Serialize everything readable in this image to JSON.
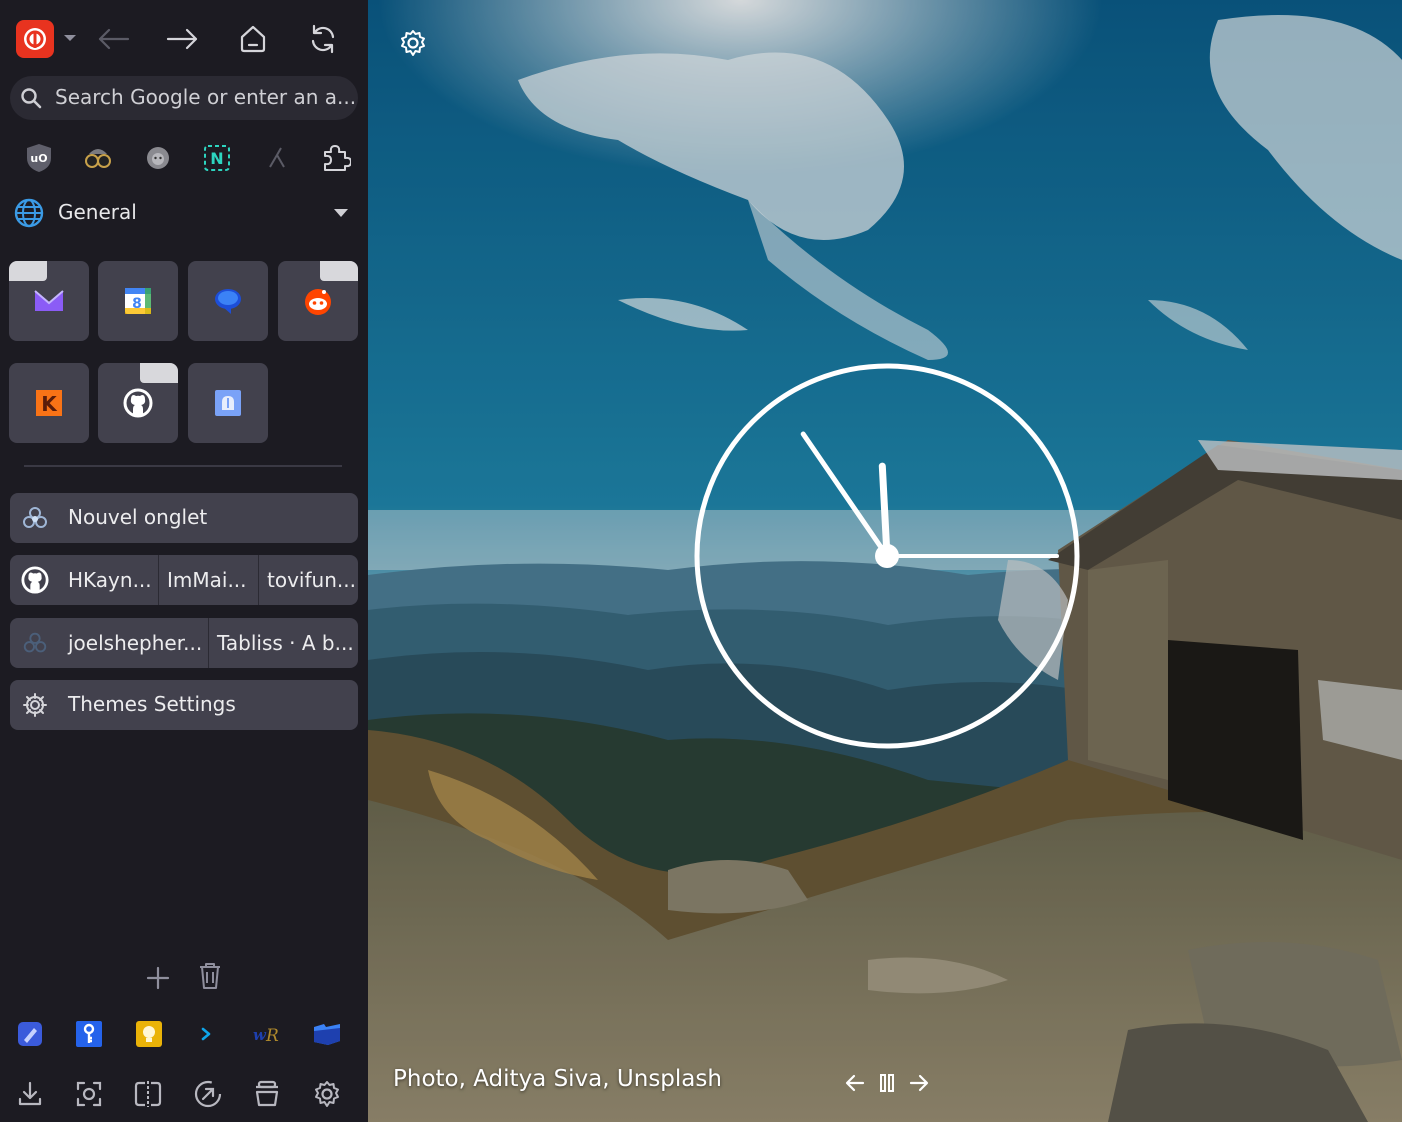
{
  "toolbar": {
    "app_icon": "floorp-logo-icon",
    "dropdown_icon": "chevron-down-icon",
    "back_icon": "arrow-left-icon",
    "forward_icon": "arrow-right-icon",
    "home_icon": "home-icon",
    "reload_icon": "reload-icon"
  },
  "search": {
    "icon": "search-icon",
    "placeholder": "Search Google or enter an a..."
  },
  "extensions": [
    {
      "name": "ublock-origin-icon"
    },
    {
      "name": "spy-glasses-icon"
    },
    {
      "name": "lion-mask-icon"
    },
    {
      "name": "notion-icon"
    },
    {
      "name": "branch-icon"
    },
    {
      "name": "puzzle-piece-icon"
    }
  ],
  "workspace": {
    "label": "General",
    "icon": "globe-icon",
    "caret": "caret-down-icon"
  },
  "pinned": [
    {
      "name": "proton-mail-pin",
      "color": "#8b5cf6"
    },
    {
      "name": "google-calendar-pin",
      "color": "#4285f4"
    },
    {
      "name": "messages-pin",
      "color": "#2563eb"
    },
    {
      "name": "reddit-pin",
      "color": "#ff4500"
    },
    {
      "name": "kagi-pin",
      "color": "#f97316"
    },
    {
      "name": "github-pin",
      "color": "#ffffff"
    },
    {
      "name": "app-pin",
      "color": "#7aa2f7"
    }
  ],
  "tabs": {
    "nouvel_onglet": "Nouvel onglet",
    "split1": [
      "HKayn...",
      "ImMai...",
      "tovifun..."
    ],
    "split2": [
      "joelshepher...",
      "Tabliss · A b..."
    ],
    "themes": "Themes Settings"
  },
  "bottom": {
    "add_icon": "plus-icon",
    "trash_icon": "trash-icon",
    "apps": [
      {
        "name": "blue-pen-app-icon",
        "color": "#3b5bdb"
      },
      {
        "name": "key-app-icon",
        "color": "#2563eb"
      },
      {
        "name": "bulb-app-icon",
        "color": "#eab308"
      },
      {
        "name": "terminal-app-icon",
        "color": "#0ea5e9"
      },
      {
        "name": "wordreference-app-icon",
        "color": "#1e40af"
      },
      {
        "name": "folder-app-icon",
        "color": "#3b82f6"
      }
    ],
    "tools": [
      "download-icon",
      "screenshot-icon",
      "split-view-icon",
      "speed-dial-icon",
      "stack-icon",
      "settings-icon"
    ]
  },
  "newtab": {
    "settings_icon": "gear-icon",
    "photo_credit": "Photo, Aditya Siva, Unsplash",
    "prev_icon": "arrow-left-icon",
    "pause_icon": "pause-icon",
    "next_icon": "arrow-right-icon",
    "clock": {
      "hour": 11,
      "minute": 54,
      "second": 15
    }
  }
}
